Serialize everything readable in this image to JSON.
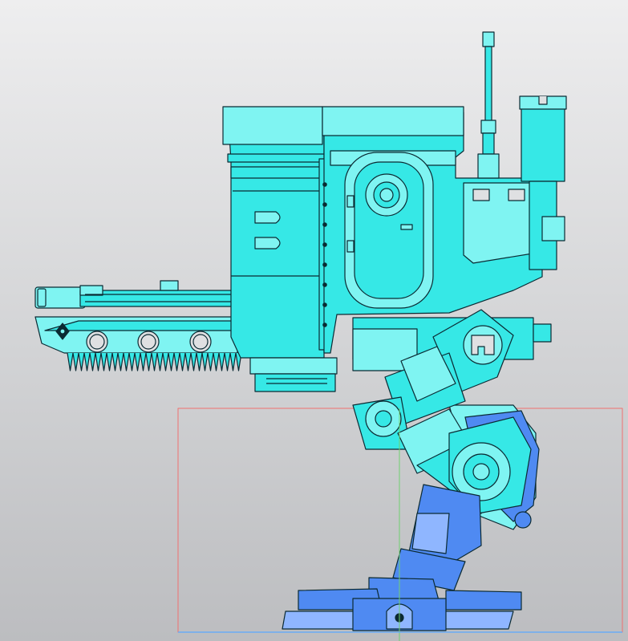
{
  "viewport": {
    "background_top": "#eeeeef",
    "background_bottom": "#bcbdc0"
  },
  "model": {
    "body_color": "#36e8e6",
    "body_light_color": "#7ff4f2",
    "body_shade_color": "#24c8c8",
    "leg_color": "#4f8af2",
    "leg_light_color": "#8fb6ff",
    "edge_color": "#0b2a33"
  },
  "overlay": {
    "bounding_box_color": "#f07070",
    "vertical_axis_color": "#70d070",
    "horizontal_axis_color": "#5aa8ff"
  }
}
